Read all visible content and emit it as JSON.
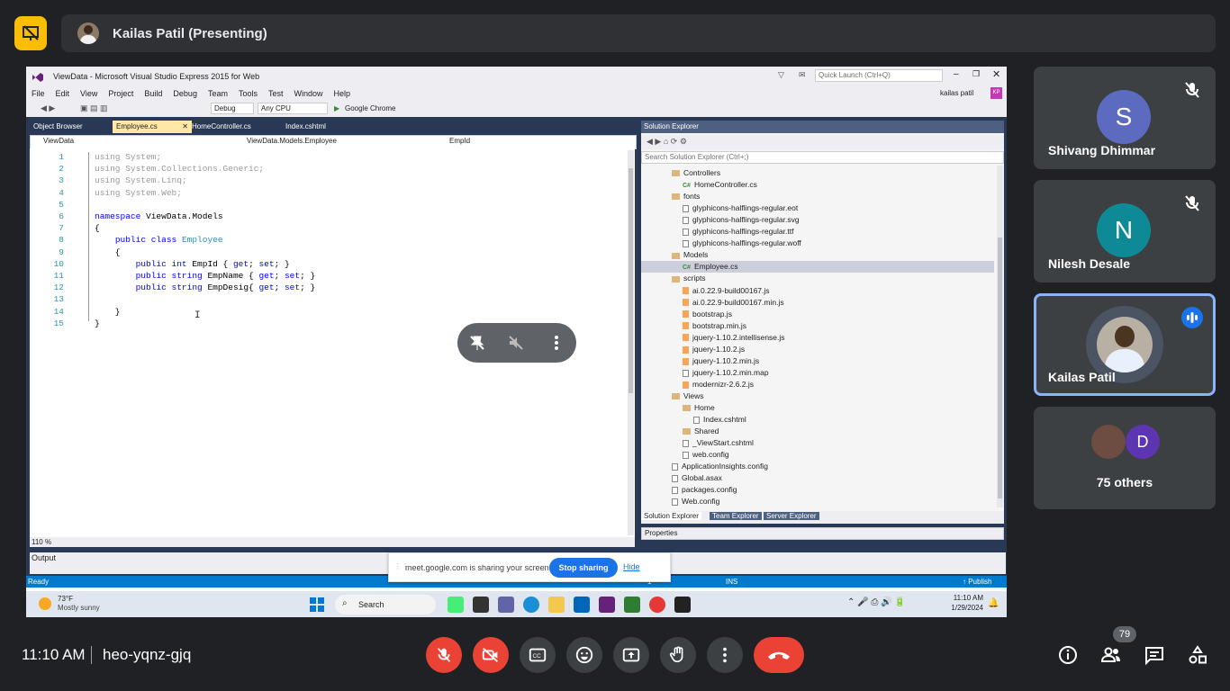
{
  "presenter": {
    "label": "Kailas Patil (Presenting)"
  },
  "vs": {
    "title": "ViewData - Microsoft Visual Studio Express 2015 for Web",
    "quick_launch": "Quick Launch (Ctrl+Q)",
    "user": "kailas patil",
    "user_initials": "KP",
    "menu": [
      "File",
      "Edit",
      "View",
      "Project",
      "Build",
      "Debug",
      "Team",
      "Tools",
      "Test",
      "Window",
      "Help"
    ],
    "config": "Debug",
    "platform": "Any CPU",
    "run_target": "Google Chrome",
    "tabs": [
      "Object Browser",
      "Employee.cs",
      "HomeController.cs",
      "Index.cshtml"
    ],
    "nav_project": "ViewData",
    "nav_class": "ViewData.Models.Employee",
    "nav_member": "EmpId",
    "zoom": "110 %",
    "output_label": "Output",
    "status": {
      "ready": "Ready",
      "col": "1",
      "ins": "INS",
      "publish": "↑ Publish"
    },
    "solution_explorer": {
      "title": "Solution Explorer",
      "search": "Search Solution Explorer (Ctrl+;)",
      "tabs": [
        "Solution Explorer",
        "Team Explorer",
        "Server Explorer"
      ],
      "properties": "Properties",
      "items": [
        {
          "label": "Controllers",
          "kind": "folder",
          "depth": 2
        },
        {
          "label": "HomeController.cs",
          "kind": "cs",
          "depth": 3
        },
        {
          "label": "fonts",
          "kind": "folder",
          "depth": 2
        },
        {
          "label": "glyphicons-halflings-regular.eot",
          "kind": "file",
          "depth": 3
        },
        {
          "label": "glyphicons-halflings-regular.svg",
          "kind": "file",
          "depth": 3
        },
        {
          "label": "glyphicons-halflings-regular.ttf",
          "kind": "file",
          "depth": 3
        },
        {
          "label": "glyphicons-halflings-regular.woff",
          "kind": "file",
          "depth": 3
        },
        {
          "label": "Models",
          "kind": "folder",
          "depth": 2
        },
        {
          "label": "Employee.cs",
          "kind": "cs",
          "depth": 3,
          "selected": true
        },
        {
          "label": "scripts",
          "kind": "folder",
          "depth": 2
        },
        {
          "label": "ai.0.22.9-build00167.js",
          "kind": "js",
          "depth": 3
        },
        {
          "label": "ai.0.22.9-build00167.min.js",
          "kind": "js",
          "depth": 3
        },
        {
          "label": "bootstrap.js",
          "kind": "js",
          "depth": 3
        },
        {
          "label": "bootstrap.min.js",
          "kind": "js",
          "depth": 3
        },
        {
          "label": "jquery-1.10.2.intellisense.js",
          "kind": "js",
          "depth": 3
        },
        {
          "label": "jquery-1.10.2.js",
          "kind": "js",
          "depth": 3
        },
        {
          "label": "jquery-1.10.2.min.js",
          "kind": "js",
          "depth": 3
        },
        {
          "label": "jquery-1.10.2.min.map",
          "kind": "file",
          "depth": 3
        },
        {
          "label": "modernizr-2.6.2.js",
          "kind": "js",
          "depth": 3
        },
        {
          "label": "Views",
          "kind": "folder",
          "depth": 2
        },
        {
          "label": "Home",
          "kind": "folder",
          "depth": 3
        },
        {
          "label": "Index.cshtml",
          "kind": "file",
          "depth": 4
        },
        {
          "label": "Shared",
          "kind": "folder",
          "depth": 3
        },
        {
          "label": "_ViewStart.cshtml",
          "kind": "file",
          "depth": 3
        },
        {
          "label": "web.config",
          "kind": "file",
          "depth": 3
        },
        {
          "label": "ApplicationInsights.config",
          "kind": "file",
          "depth": 2
        },
        {
          "label": "Global.asax",
          "kind": "file",
          "depth": 2
        },
        {
          "label": "packages.config",
          "kind": "file",
          "depth": 2
        },
        {
          "label": "Web.config",
          "kind": "file",
          "depth": 2
        }
      ]
    },
    "code_lines": [
      {
        "n": "1",
        "t": "using System;",
        "dim": true
      },
      {
        "n": "2",
        "t": "using System.Collections.Generic;",
        "dim": true
      },
      {
        "n": "3",
        "t": "using System.Linq;",
        "dim": true
      },
      {
        "n": "4",
        "t": "using System.Web;",
        "dim": true
      },
      {
        "n": "5",
        "t": ""
      },
      {
        "n": "6",
        "t": "namespace ViewData.Models"
      },
      {
        "n": "7",
        "t": "{"
      },
      {
        "n": "8",
        "t": "    public class Employee"
      },
      {
        "n": "9",
        "t": "    {"
      },
      {
        "n": "10",
        "t": "        public int EmpId { get; set; }"
      },
      {
        "n": "11",
        "t": "        public string EmpName { get; set; }"
      },
      {
        "n": "12",
        "t": "        public string EmpDesig{ get; set; }"
      },
      {
        "n": "13",
        "t": ""
      },
      {
        "n": "14",
        "t": "    }"
      },
      {
        "n": "15",
        "t": "}"
      }
    ]
  },
  "share_banner": {
    "text": "meet.google.com is sharing your screen.",
    "stop": "Stop sharing",
    "hide": "Hide"
  },
  "taskbar": {
    "weather_temp": "73°F",
    "weather_desc": "Mostly sunny",
    "search": "Search",
    "time": "11:10 AM",
    "date": "1/29/2024"
  },
  "participants": [
    {
      "name": "Shivang Dhimmar",
      "initial": "S",
      "color": "#5c6bc0"
    },
    {
      "name": "Nilesh Desale",
      "initial": "N",
      "color": "#0e8a96"
    },
    {
      "name": "Kailas Patil"
    }
  ],
  "others": {
    "label": "75 others",
    "initial": "D",
    "color": "#5e35b1"
  },
  "meeting": {
    "time": "11:10 AM",
    "code": "heo-yqnz-gjq",
    "people_count": "79"
  },
  "colors": {
    "accent": "#8ab4f8",
    "danger": "#ea4335",
    "brand": "#fbbc04"
  }
}
